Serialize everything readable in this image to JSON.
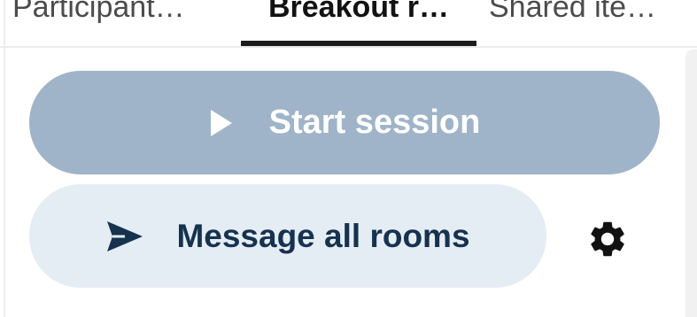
{
  "tabs": [
    {
      "label": "Participant…",
      "selected": false
    },
    {
      "label": "Breakout r…",
      "selected": true
    },
    {
      "label": "Shared ite…",
      "selected": false
    }
  ],
  "actions": {
    "start_session": {
      "label": "Start session",
      "icon": "play-icon"
    },
    "message_all_rooms": {
      "label": "Message all rooms",
      "icon": "send-icon"
    },
    "settings": {
      "icon": "gear-icon"
    }
  },
  "colors": {
    "start_button_bg": "#9fb4c8",
    "message_button_bg": "#e5edf4",
    "message_text": "#16324f",
    "tab_selected_underline": "#1c1c1c"
  }
}
